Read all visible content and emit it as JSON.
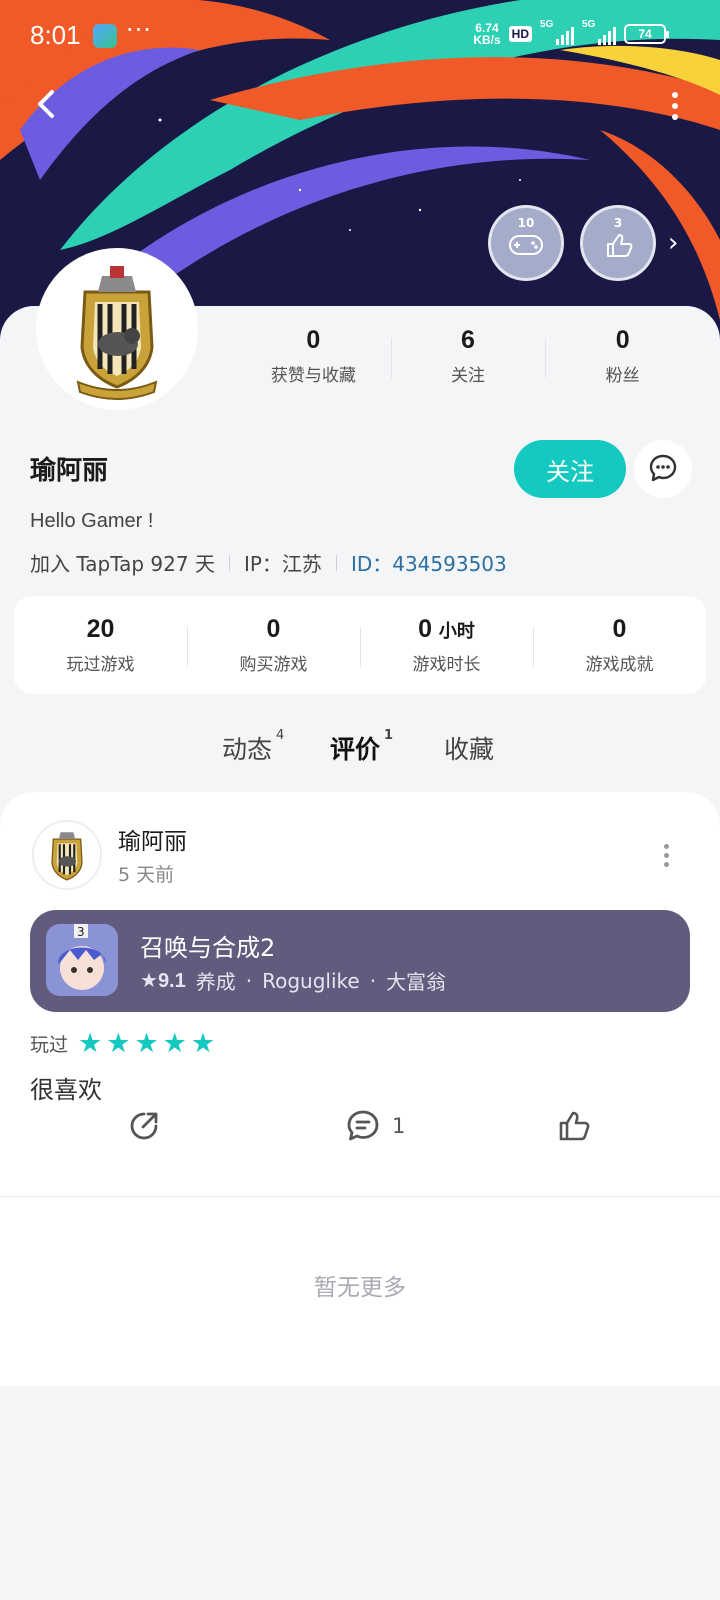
{
  "status_bar": {
    "time": "8:01",
    "more": "···",
    "net_speed_value": "6.74",
    "net_speed_unit": "KB/s",
    "hd": "HD",
    "signal_1": "5G",
    "signal_2": "5G",
    "battery": "74"
  },
  "header": {
    "badges": [
      {
        "number": "10",
        "icon": "gamepad-icon"
      },
      {
        "number": "3",
        "icon": "thumbs-up-icon"
      }
    ]
  },
  "profile": {
    "name": "瑜阿丽",
    "follow_label": "关注",
    "bio": "Hello Gamer !",
    "joined": "加入 TapTap 927 天",
    "ip": "IP：江苏",
    "id": "ID：434593503",
    "top_stats": [
      {
        "value": "0",
        "label": "获赞与收藏"
      },
      {
        "value": "6",
        "label": "关注"
      },
      {
        "value": "0",
        "label": "粉丝"
      }
    ],
    "game_stats": [
      {
        "value": "20",
        "unit": "",
        "label": "玩过游戏"
      },
      {
        "value": "0",
        "unit": "",
        "label": "购买游戏"
      },
      {
        "value": "0",
        "unit": "小时",
        "label": "游戏时长"
      },
      {
        "value": "0",
        "unit": "",
        "label": "游戏成就"
      }
    ]
  },
  "tabs": [
    {
      "label": "动态",
      "count": "4"
    },
    {
      "label": "评价",
      "count": "1",
      "active": true
    },
    {
      "label": "收藏",
      "count": ""
    }
  ],
  "post": {
    "author": "瑜阿丽",
    "time": "5 天前",
    "game": {
      "title": "召唤与合成2",
      "score": "9.1",
      "tags": [
        "养成",
        "Roguglike",
        "大富翁"
      ],
      "icon_badge": "3"
    },
    "played_label": "玩过",
    "rating": 5,
    "text": "很喜欢",
    "comment_count": "1"
  },
  "footer": {
    "no_more": "暂无更多"
  },
  "colors": {
    "accent": "#14c9c0",
    "banner_bg": "#1a1845",
    "game_card": "#625b7d",
    "id_link": "#2c6fa0"
  }
}
